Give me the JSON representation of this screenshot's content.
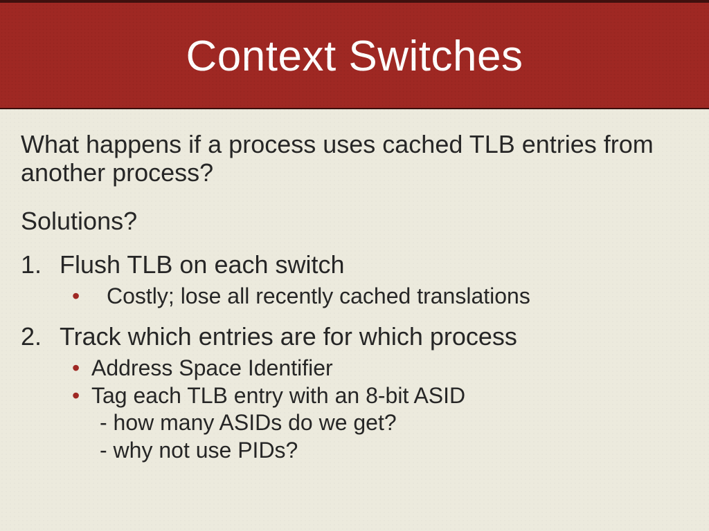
{
  "title": "Context Switches",
  "lead": "What happens if a process uses cached TLB entries from another process?",
  "subhead": "Solutions?",
  "items": [
    {
      "num": "1.",
      "label": "Flush TLB on each switch",
      "bullets": [
        {
          "text": "Costly; lose all recently cached translations"
        }
      ]
    },
    {
      "num": "2.",
      "label": "Track which entries are for which process",
      "bullets": [
        {
          "text": "Address Space Identifier"
        },
        {
          "text": "Tag each TLB entry with an 8-bit ASID",
          "sublines": [
            "- how many ASIDs do we get?",
            "- why not use PIDs?"
          ]
        }
      ]
    }
  ]
}
